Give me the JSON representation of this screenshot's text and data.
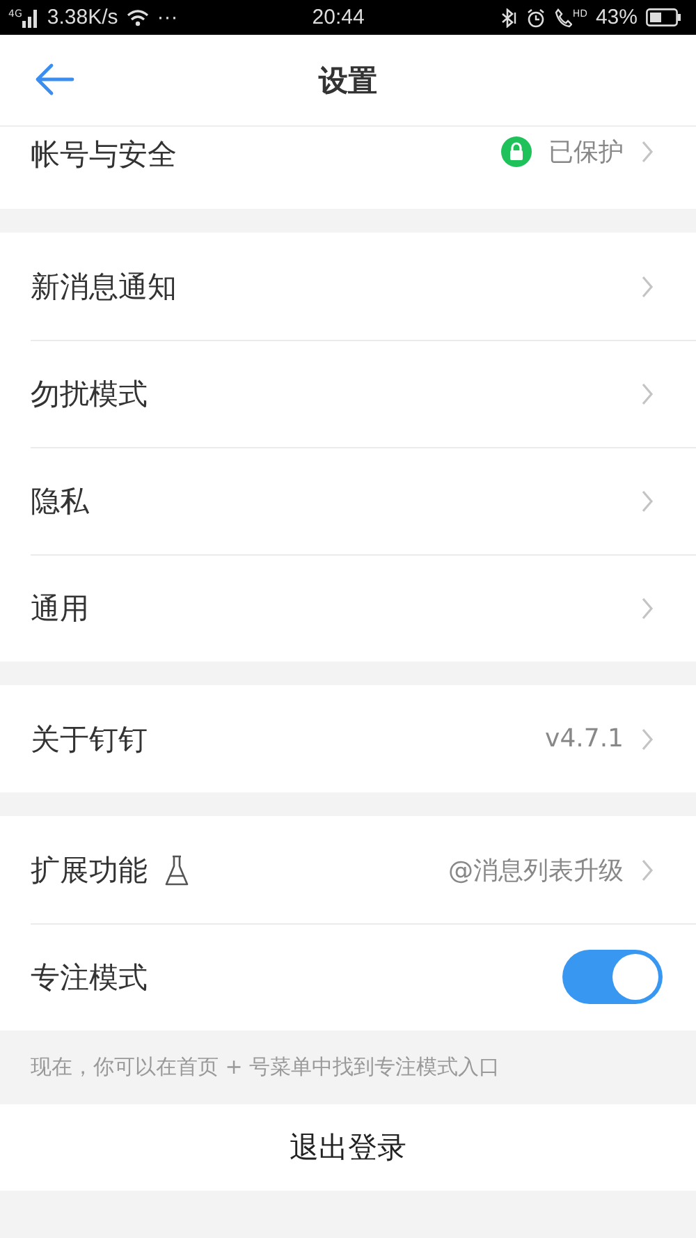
{
  "status_bar": {
    "network": "4G",
    "speed": "3.38K/s",
    "more": "···",
    "time": "20:44",
    "hd": "HD",
    "battery_percent": "43%"
  },
  "header": {
    "title": "设置"
  },
  "sections": [
    {
      "rows": [
        {
          "kind": "link",
          "label": "帐号与安全",
          "value": "已保护",
          "protected": true
        }
      ]
    },
    {
      "rows": [
        {
          "kind": "link",
          "label": "新消息通知"
        },
        {
          "kind": "link",
          "label": "勿扰模式"
        },
        {
          "kind": "link",
          "label": "隐私"
        },
        {
          "kind": "link",
          "label": "通用"
        }
      ]
    },
    {
      "rows": [
        {
          "kind": "link",
          "label": "关于钉钉",
          "value": "v4.7.1"
        }
      ]
    },
    {
      "rows": [
        {
          "kind": "link",
          "label": "扩展功能",
          "experimental": true,
          "value": "@消息列表升级"
        },
        {
          "kind": "toggle",
          "label": "专注模式",
          "on": true
        }
      ]
    }
  ],
  "note": "现在，你可以在首页 + 号菜单中找到专注模式入口",
  "logout": "退出登录"
}
